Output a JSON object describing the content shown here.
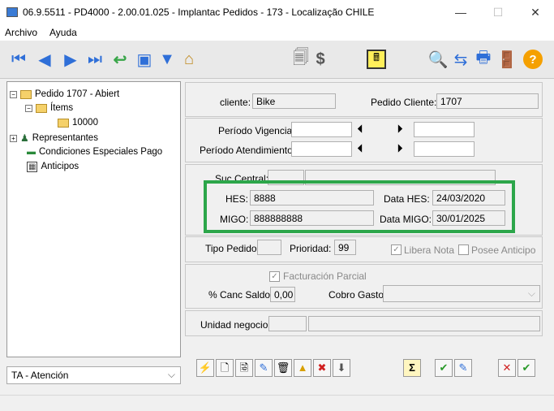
{
  "window": {
    "title": "06.9.5511 - PD4000 - 2.00.01.025 - Implantac Pedidos - 173 - Localização CHILE",
    "minimize": "—",
    "maximize": "☐",
    "close": "✕"
  },
  "menu": {
    "file": "Archivo",
    "help": "Ayuda"
  },
  "toolbar": {
    "first": "⏮",
    "prev": "◀",
    "next": "▶",
    "last": "⏭",
    "back": "↩",
    "screen": "▣",
    "filter": "▼",
    "home": "⌂",
    "clip": "🗐",
    "money": "$",
    "calc": "🖩",
    "search": "🔍",
    "tree": "⇆",
    "print": "🖶",
    "exit": "🚪",
    "help": "?"
  },
  "tree": {
    "items": [
      {
        "label": "Pedido 1707 - Abiert"
      },
      {
        "label": "Ítems"
      },
      {
        "label": "10000"
      },
      {
        "label": "Representantes"
      },
      {
        "label": "Condiciones Especiales Pago"
      },
      {
        "label": "Anticipos"
      }
    ],
    "combo_value": "TA - Atención"
  },
  "client": {
    "label": "cliente:",
    "value": "Bike",
    "pedido_label": "Pedido Cliente:",
    "pedido_value": "1707"
  },
  "periods": {
    "vigencia_label": "Período Vigencia:",
    "atendimiento_label": "Período Atendimiento:"
  },
  "suc": {
    "label": "Suc Central:",
    "hes_label": "HES:",
    "hes_value": "8888",
    "data_hes_label": "Data HES:",
    "data_hes_value": "24/03/2020",
    "migo_label": "MIGO:",
    "migo_value": "888888888",
    "data_migo_label": "Data MIGO:",
    "data_migo_value": "30/01/2025"
  },
  "tipo": {
    "label": "Tipo Pedido:",
    "prioridad_label": "Prioridad:",
    "prioridad_value": "99",
    "libera_label": "Libera Nota",
    "posee_label": "Posee Anticipo"
  },
  "factura": {
    "parcial_label": "Facturación Parcial",
    "canc_label": "% Canc Saldo:",
    "canc_value": "0,00",
    "cobro_label": "Cobro Gasto:"
  },
  "unidad": {
    "label": "Unidad negocio:"
  },
  "bottom": {
    "b1": "⚡",
    "b2": "🗋",
    "b3": "🗟",
    "b4": "✎",
    "b5": "🗑",
    "b6": "▲",
    "b7": "✖",
    "b8": "⬇",
    "sigma": "Σ",
    "ok": "✔",
    "edit": "✎",
    "cancel": "✕",
    "confirm": "✔"
  }
}
